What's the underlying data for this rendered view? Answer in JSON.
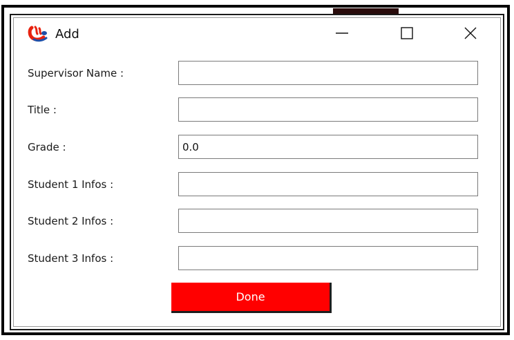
{
  "window": {
    "title": "Add",
    "icon": "java-logo-icon",
    "controls": [
      "minimize-icon",
      "maximize-icon",
      "close-icon"
    ]
  },
  "form": {
    "fields": [
      {
        "label": "Supervisor Name :",
        "value": ""
      },
      {
        "label": "Title :",
        "value": ""
      },
      {
        "label": "Grade :",
        "value": "0.0"
      },
      {
        "label": "Student 1 Infos :",
        "value": ""
      },
      {
        "label": "Student 2 Infos :",
        "value": ""
      },
      {
        "label": "Student 3 Infos :",
        "value": ""
      }
    ],
    "submit_label": "Done"
  },
  "colors": {
    "accent": "#ff0000",
    "button_text": "#ffffff",
    "logo_red": "#e8220f",
    "logo_blue": "#1f4fa8"
  }
}
